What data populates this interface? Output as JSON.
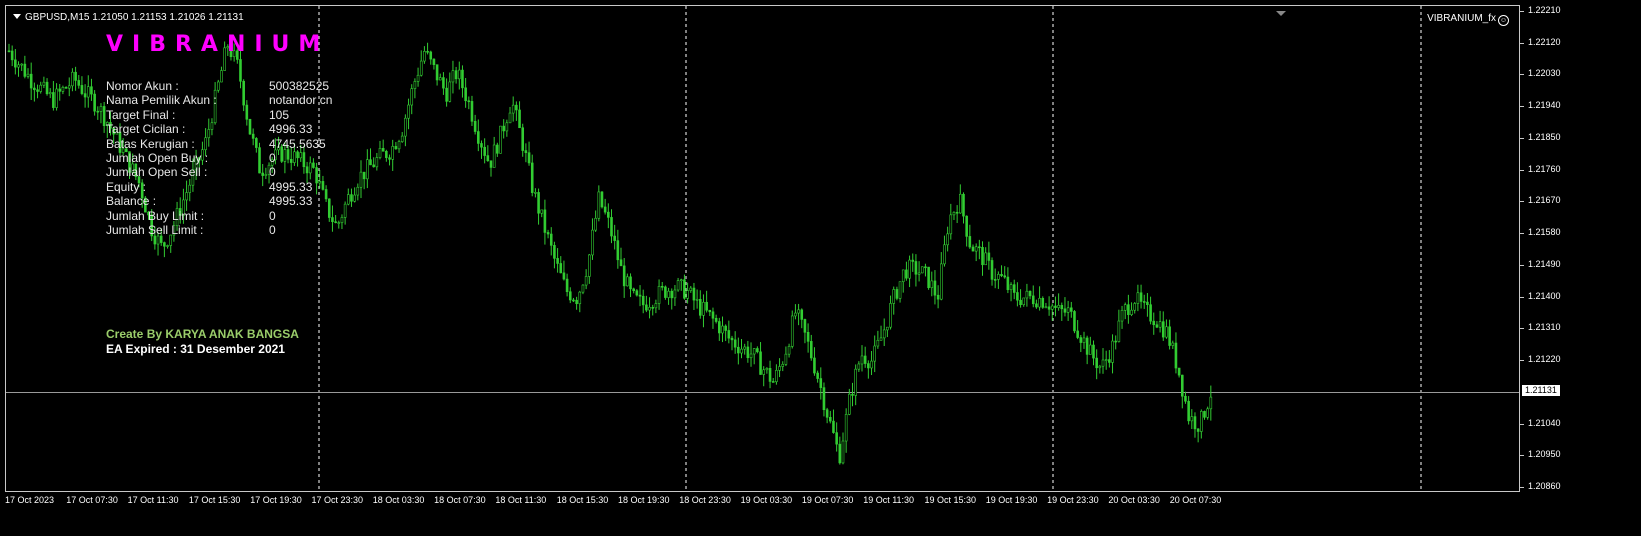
{
  "header": {
    "symbol_line": "GBPUSD,M15  1.21050 1.21153 1.21026 1.21131",
    "indicator_name": "VIBRANIUM_fx"
  },
  "panel": {
    "brand": "VIBRANIUM",
    "rows": [
      {
        "label": "Nomor Akun :",
        "value": "500382525"
      },
      {
        "label": "Nama Pemilik Akun :",
        "value": "notandor cn"
      },
      {
        "label": "Target Final :",
        "value": "105"
      },
      {
        "label": "Target Cicilan :",
        "value": "4996.33"
      },
      {
        "label": "Batas Kerugian :",
        "value": "4745.5635"
      },
      {
        "label": "Jumlah Open Buy :",
        "value": "0"
      },
      {
        "label": "Jumlah Open Sell :",
        "value": "0"
      },
      {
        "label": "Equity :",
        "value": "4995.33"
      },
      {
        "label": "Balance :",
        "value": "4995.33"
      },
      {
        "label": "Jumlah Buy Limit :",
        "value": "0"
      },
      {
        "label": "Jumlah Sell Limit :",
        "value": "0"
      }
    ],
    "credit": "Create By KARYA ANAK BANGSA",
    "expiry": "EA Expired : 31 Desember 2021"
  },
  "price_axis": {
    "labels": [
      "1.22210",
      "1.22120",
      "1.22030",
      "1.21940",
      "1.21850",
      "1.21760",
      "1.21670",
      "1.21580",
      "1.21490",
      "1.21400",
      "1.21310",
      "1.21220",
      "1.21040",
      "1.20950",
      "1.20860"
    ],
    "current_price": "1.21131"
  },
  "time_axis": {
    "labels": [
      "17 Oct 2023",
      "17 Oct 07:30",
      "17 Oct 11:30",
      "17 Oct 15:30",
      "17 Oct 19:30",
      "17 Oct 23:30",
      "18 Oct 03:30",
      "18 Oct 07:30",
      "18 Oct 11:30",
      "18 Oct 15:30",
      "18 Oct 19:30",
      "18 Oct 23:30",
      "19 Oct 03:30",
      "19 Oct 07:30",
      "19 Oct 11:30",
      "19 Oct 15:30",
      "19 Oct 19:30",
      "19 Oct 23:30",
      "20 Oct 03:30",
      "20 Oct 07:30"
    ]
  },
  "colors": {
    "background": "#000000",
    "candle": "#32cd32",
    "grid": "#ffffff",
    "brand": "#ff00ff",
    "credit": "#9acd6a"
  },
  "chart_data": {
    "type": "line",
    "series": [
      {
        "values": [
          1.221,
          1.2206,
          1.2202,
          1.2199,
          1.2196,
          1.2199,
          1.2202,
          1.2198,
          1.2195,
          1.219,
          1.2184,
          1.2178,
          1.2172,
          1.216,
          1.2154,
          1.216,
          1.2168,
          1.2176,
          1.2184,
          1.2198,
          1.2212,
          1.2205,
          1.2188,
          1.2176,
          1.2179,
          1.2181,
          1.218,
          1.2178,
          1.2176,
          1.2166,
          1.216,
          1.2168,
          1.2174,
          1.2177,
          1.218,
          1.2182,
          1.2188,
          1.22,
          1.221,
          1.2204,
          1.2198,
          1.2204,
          1.2196,
          1.2186,
          1.2178,
          1.2186,
          1.2196,
          1.2184,
          1.217,
          1.216,
          1.215,
          1.2142,
          1.214,
          1.215,
          1.2168,
          1.216,
          1.2148,
          1.214,
          1.2138,
          1.214,
          1.2142,
          1.2143,
          1.2142,
          1.2138,
          1.2135,
          1.2132,
          1.2128,
          1.2126,
          1.2124,
          1.212,
          1.2116,
          1.2124,
          1.2136,
          1.2128,
          1.2118,
          1.2106,
          1.2095,
          1.2112,
          1.2124,
          1.2122,
          1.213,
          1.214,
          1.2148,
          1.2148,
          1.2146,
          1.214,
          1.2162,
          1.2168,
          1.2155,
          1.2152,
          1.2147,
          1.2145,
          1.214,
          1.214,
          1.214,
          1.2139,
          1.2136,
          1.2136,
          1.213,
          1.2124,
          1.212,
          1.2126,
          1.2136,
          1.214,
          1.2136,
          1.2134,
          1.213,
          1.212,
          1.2106,
          1.2104,
          1.2113
        ]
      }
    ],
    "ylim": [
      1.2086,
      1.2221
    ],
    "categories": [
      "17 Oct 2023",
      "17 Oct 07:30",
      "17 Oct 11:30",
      "17 Oct 15:30",
      "17 Oct 19:30",
      "17 Oct 23:30",
      "18 Oct 03:30",
      "18 Oct 07:30",
      "18 Oct 11:30",
      "18 Oct 15:30",
      "18 Oct 19:30",
      "18 Oct 23:30",
      "19 Oct 03:30",
      "19 Oct 07:30",
      "19 Oct 11:30",
      "19 Oct 15:30",
      "19 Oct 19:30",
      "19 Oct 23:30",
      "20 Oct 03:30",
      "20 Oct 07:30"
    ],
    "grid": "vertical dashed"
  }
}
